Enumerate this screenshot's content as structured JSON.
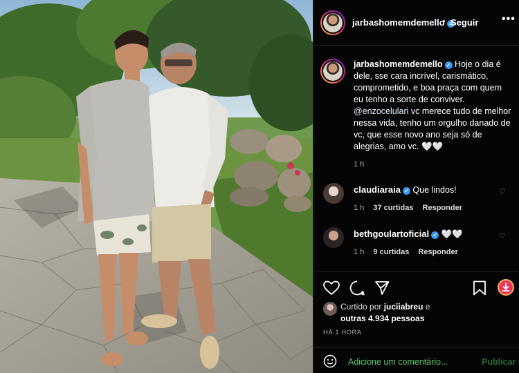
{
  "post": {
    "username": "jarbashomemdemello",
    "verified_icon": "verified-badge-icon",
    "follow_label": "Seguir",
    "separator": "•",
    "more_label": "•••"
  },
  "caption": {
    "username": "jarbashomemdemello",
    "text_before_mention": "Hoje o dia é dele, sse cara incrível, carismático, comprometido, e boa praça com quem eu tenho a sorte de conviver.",
    "mention": "@enzocelulari",
    "text_after_mention": "vc merece tudo de melhor nessa vida, tenho um orgulho danado de vc, que esse novo ano seja só de alegrias, amo vc. 🤍🤍",
    "time": "1 h"
  },
  "comments": [
    {
      "username": "claudiaraia",
      "text": "Que lindos!",
      "time": "1 h",
      "likes": "37 curtidas",
      "reply": "Responder"
    },
    {
      "username": "bethgoulartoficial",
      "text": "🤍🤍",
      "time": "1 h",
      "likes": "9 curtidas",
      "reply": "Responder"
    }
  ],
  "likes": {
    "prefix": "Curtido por",
    "user": "juciiabreu",
    "conj": "e",
    "others": "outras 4.934 pessoas"
  },
  "timestamp": "HÁ 1 HORA",
  "add_comment": {
    "placeholder": "Adicione um comentário...",
    "publish_label": "Publicar"
  },
  "colors": {
    "accent_blue": "#3897f0",
    "add_comment_green": "#5ec76a",
    "download_badge": "#e8365d"
  }
}
